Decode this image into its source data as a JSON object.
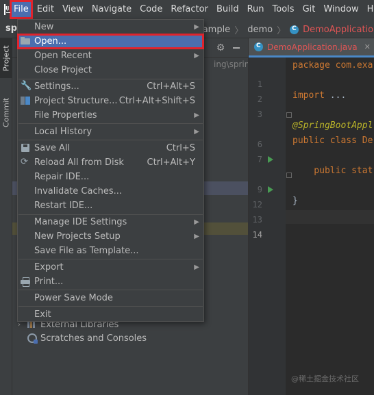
{
  "menubar": {
    "items": [
      "File",
      "Edit",
      "View",
      "Navigate",
      "Code",
      "Refactor",
      "Build",
      "Run",
      "Tools",
      "Git",
      "Window",
      "Help"
    ]
  },
  "navbar": {
    "project_fragment": "spr",
    "crumbs": [
      "xample",
      "demo",
      "DemoApplication"
    ]
  },
  "toolstrip": {
    "project": "Project",
    "commit": "Commit"
  },
  "project_pane": {
    "path_fragment": "ing\\spring-",
    "tree": [
      {
        "label": "External Libraries"
      },
      {
        "label": "Scratches and Consoles"
      }
    ]
  },
  "editor": {
    "tab_title": "DemoApplication.java",
    "line_numbers": [
      "1",
      "2",
      "3",
      "6",
      "7",
      "9",
      "12",
      "13",
      "14"
    ],
    "code": {
      "l1": "package com.exa",
      "l3_kw": "import",
      "l3_rest": " ...",
      "l6": "@SpringBootAppl",
      "l7": "public class De",
      "l9": "    public stat",
      "l13": "}"
    }
  },
  "file_menu": {
    "items": [
      {
        "label": "New",
        "shortcut": "",
        "submenu": true,
        "icon": ""
      },
      {
        "label": "Open...",
        "shortcut": "",
        "submenu": false,
        "icon": "folder-icon",
        "selected": true
      },
      {
        "label": "Open Recent",
        "shortcut": "",
        "submenu": true,
        "icon": ""
      },
      {
        "label": "Close Project",
        "shortcut": "",
        "submenu": false,
        "icon": ""
      },
      {
        "label": "Settings...",
        "shortcut": "Ctrl+Alt+S",
        "submenu": false,
        "icon": "wrench-icon"
      },
      {
        "label": "Project Structure...",
        "shortcut": "Ctrl+Alt+Shift+S",
        "submenu": false,
        "icon": "project-structure-icon"
      },
      {
        "label": "File Properties",
        "shortcut": "",
        "submenu": true,
        "icon": ""
      },
      {
        "label": "Local History",
        "shortcut": "",
        "submenu": true,
        "icon": ""
      },
      {
        "label": "Save All",
        "shortcut": "Ctrl+S",
        "submenu": false,
        "icon": "save-icon"
      },
      {
        "label": "Reload All from Disk",
        "shortcut": "Ctrl+Alt+Y",
        "submenu": false,
        "icon": "reload-icon"
      },
      {
        "label": "Repair IDE...",
        "shortcut": "",
        "submenu": false,
        "icon": ""
      },
      {
        "label": "Invalidate Caches...",
        "shortcut": "",
        "submenu": false,
        "icon": ""
      },
      {
        "label": "Restart IDE...",
        "shortcut": "",
        "submenu": false,
        "icon": ""
      },
      {
        "label": "Manage IDE Settings",
        "shortcut": "",
        "submenu": true,
        "icon": ""
      },
      {
        "label": "New Projects Setup",
        "shortcut": "",
        "submenu": true,
        "icon": ""
      },
      {
        "label": "Save File as Template...",
        "shortcut": "",
        "submenu": false,
        "icon": ""
      },
      {
        "label": "Export",
        "shortcut": "",
        "submenu": true,
        "icon": ""
      },
      {
        "label": "Print...",
        "shortcut": "",
        "submenu": false,
        "icon": "print-icon"
      },
      {
        "label": "Power Save Mode",
        "shortcut": "",
        "submenu": false,
        "icon": ""
      },
      {
        "label": "Exit",
        "shortcut": "",
        "submenu": false,
        "icon": ""
      }
    ]
  },
  "watermark": "@稀土掘金技术社区",
  "colors": {
    "accent": "#4b6eaf",
    "highlight_border": "#e0242d",
    "background": "#2b2b2b",
    "panel": "#3c3f41"
  }
}
